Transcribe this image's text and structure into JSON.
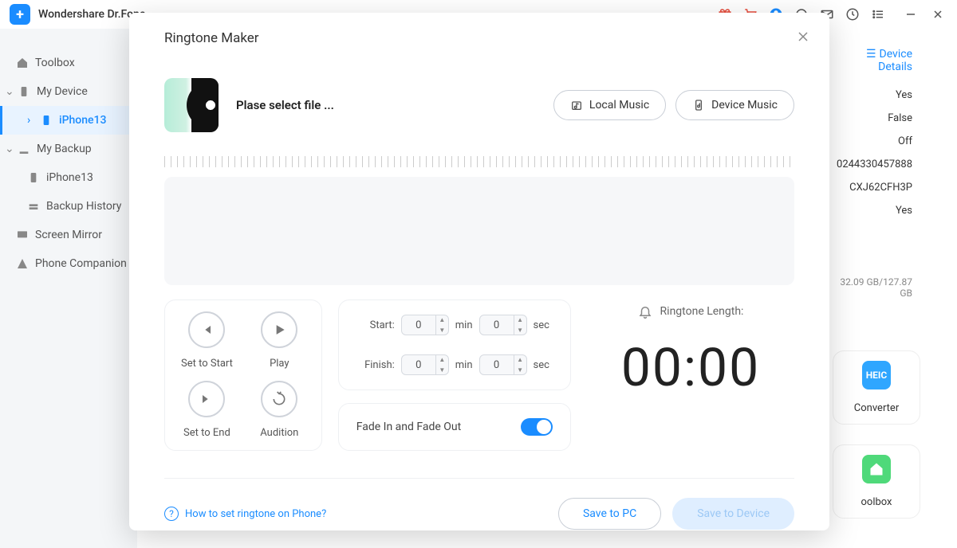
{
  "app": {
    "title": "Wondershare Dr.Fone"
  },
  "sidebar": {
    "toolbox": "Toolbox",
    "mydevice": "My Device",
    "iphone": "iPhone13",
    "mybackup": "My Backup",
    "backup_iphone": "iPhone13",
    "backup_history": "Backup History",
    "screen_mirror": "Screen Mirror",
    "phone_companion": "Phone Companion"
  },
  "bg": {
    "device_details_label": "Device Details",
    "val1": "Yes",
    "val2": "False",
    "val3": "Off",
    "val4": "0244330457888",
    "val5": "CXJ62CFH3P",
    "val6": "Yes",
    "storage": "32.09 GB/127.87 GB",
    "card1_icon_text": "HEIC",
    "card1_label": "Converter",
    "card2_label": "oolbox"
  },
  "modal": {
    "title": "Ringtone Maker",
    "file_prompt": "Plase select file ...",
    "local_music": "Local Music",
    "device_music": "Device Music",
    "set_to_start": "Set to Start",
    "play": "Play",
    "set_to_end": "Set to End",
    "audition": "Audition",
    "start_label": "Start:",
    "finish_label": "Finish:",
    "min_unit": "min",
    "sec_unit": "sec",
    "start_min": "0",
    "start_sec": "0",
    "finish_min": "0",
    "finish_sec": "0",
    "fade_label": "Fade In and Fade Out",
    "fade_on": true,
    "length_label": "Ringtone Length:",
    "length_value": "00:00",
    "help_text": "How to set ringtone on Phone?",
    "save_pc": "Save to PC",
    "save_device": "Save to Device"
  }
}
